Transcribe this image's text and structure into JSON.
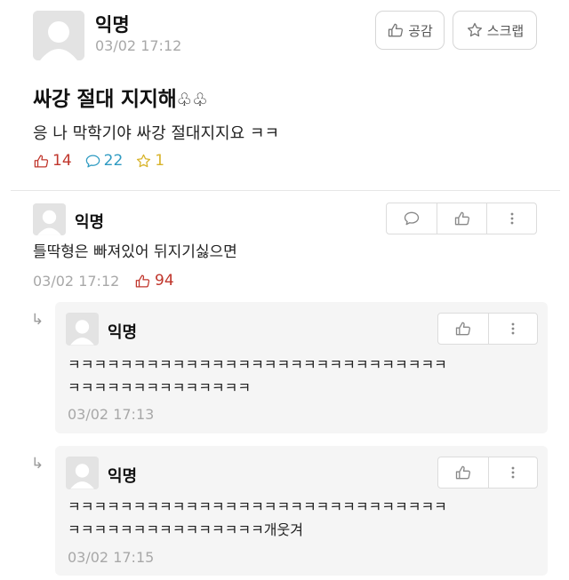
{
  "post": {
    "author": "익명",
    "time": "03/02 17:12",
    "like_button": "공감",
    "scrap_button": "스크랩",
    "title": "싸강 절대 지지해",
    "title_emoji": "♧♧",
    "body": "응 나 막학기야 싸강 절대지지요 ㅋㅋ",
    "likes": "14",
    "comments": "22",
    "scraps": "1"
  },
  "comment": {
    "author": "익명",
    "text": "틀딱형은 빠져있어 뒤지기싫으면",
    "time": "03/02 17:12",
    "likes": "94"
  },
  "replies": [
    {
      "author": "익명",
      "line1": "ㅋㅋㅋㅋㅋㅋㅋㅋㅋㅋㅋㅋㅋㅋㅋㅋㅋㅋㅋㅋㅋㅋㅋㅋㅋㅋㅋㅋㅋ",
      "line2": "ㅋㅋㅋㅋㅋㅋㅋㅋㅋㅋㅋㅋㅋㅋ",
      "time": "03/02 17:13"
    },
    {
      "author": "익명",
      "line1": "ㅋㅋㅋㅋㅋㅋㅋㅋㅋㅋㅋㅋㅋㅋㅋㅋㅋㅋㅋㅋㅋㅋㅋㅋㅋㅋㅋㅋㅋ",
      "line2": "ㅋㅋㅋㅋㅋㅋㅋㅋㅋㅋㅋㅋㅋㅋㅋ개웃겨",
      "time": "03/02 17:15"
    }
  ],
  "icons": {
    "like": "thumbs-up-icon",
    "comment": "speech-bubble-icon",
    "scrap": "star-icon",
    "more": "vertical-dots-icon",
    "reply": "reply-arrow-icon"
  },
  "colors": {
    "like": "#c0362c",
    "comment": "#2f9bc2",
    "scrap": "#d8b32a",
    "muted": "#a8a8a8",
    "reply_bg": "#f5f5f5"
  }
}
